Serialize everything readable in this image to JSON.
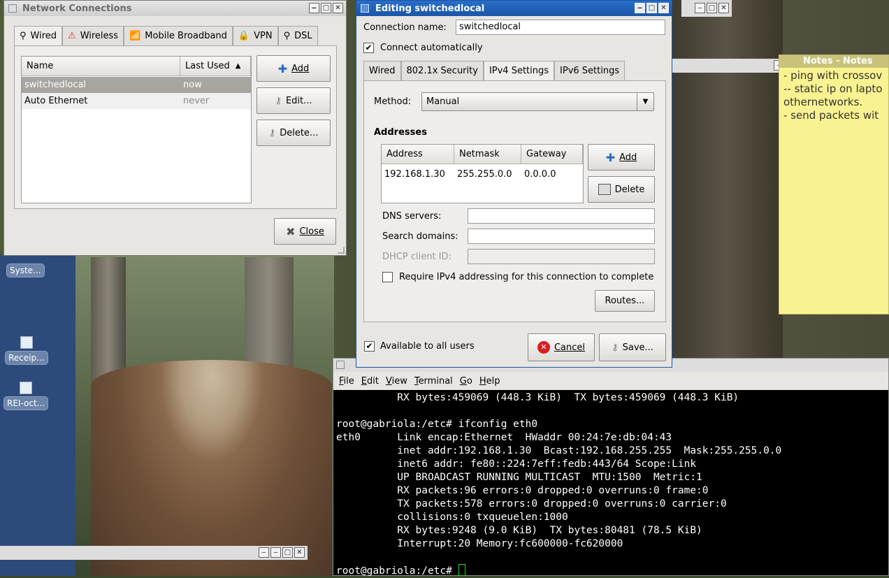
{
  "desktop": {
    "icons": [
      {
        "label": "Syste..."
      },
      {
        "label": "Receip..."
      },
      {
        "label": "REI-oct..."
      }
    ]
  },
  "network_connections": {
    "title": "Network Connections",
    "tabs": [
      "Wired",
      "Wireless",
      "Mobile Broadband",
      "VPN",
      "DSL"
    ],
    "columns": {
      "name": "Name",
      "last_used": "Last Used"
    },
    "rows": [
      {
        "name": "switchedlocal",
        "last_used": "now"
      },
      {
        "name": "Auto Ethernet",
        "last_used": "never"
      }
    ],
    "buttons": {
      "add": "Add",
      "edit": "Edit...",
      "delete": "Delete...",
      "close": "Close"
    }
  },
  "editor": {
    "title": "Editing switchedlocal",
    "connection_name_label": "Connection name:",
    "connection_name_value": "switchedlocal",
    "connect_automatically": "Connect automatically",
    "tabs": [
      "Wired",
      "802.1x Security",
      "IPv4 Settings",
      "IPv6 Settings"
    ],
    "method_label": "Method:",
    "method_value": "Manual",
    "addresses_heading": "Addresses",
    "addr_columns": {
      "address": "Address",
      "netmask": "Netmask",
      "gateway": "Gateway"
    },
    "addr_rows": [
      {
        "address": "192.168.1.30",
        "netmask": "255.255.0.0",
        "gateway": "0.0.0.0"
      }
    ],
    "add_button": "Add",
    "delete_button": "Delete",
    "dns_label": "DNS servers:",
    "search_label": "Search domains:",
    "dhcp_label": "DHCP client ID:",
    "require_ipv4": "Require IPv4 addressing for this connection to complete",
    "routes_button": "Routes...",
    "available_all": "Available to all users",
    "cancel_button": "Cancel",
    "save_button": "Save..."
  },
  "notes": {
    "title": "Notes - Notes",
    "lines": [
      "- ping with crossov",
      "-- static ip on lapto",
      "othernetworks.",
      "- send packets wit"
    ]
  },
  "terminal": {
    "menu": [
      "File",
      "Edit",
      "View",
      "Terminal",
      "Go",
      "Help"
    ],
    "lines": [
      "          RX bytes:459069 (448.3 KiB)  TX bytes:459069 (448.3 KiB)",
      "",
      "root@gabriola:/etc# ifconfig eth0",
      "eth0      Link encap:Ethernet  HWaddr 00:24:7e:db:04:43",
      "          inet addr:192.168.1.30  Bcast:192.168.255.255  Mask:255.255.0.0",
      "          inet6 addr: fe80::224:7eff:fedb:443/64 Scope:Link",
      "          UP BROADCAST RUNNING MULTICAST  MTU:1500  Metric:1",
      "          RX packets:96 errors:0 dropped:0 overruns:0 frame:0",
      "          TX packets:578 errors:0 dropped:0 overruns:0 carrier:0",
      "          collisions:0 txqueuelen:1000",
      "          RX bytes:9248 (9.0 KiB)  TX bytes:80481 (78.5 KiB)",
      "          Interrupt:20 Memory:fc600000-fc620000",
      ""
    ],
    "prompt": "root@gabriola:/etc# "
  }
}
